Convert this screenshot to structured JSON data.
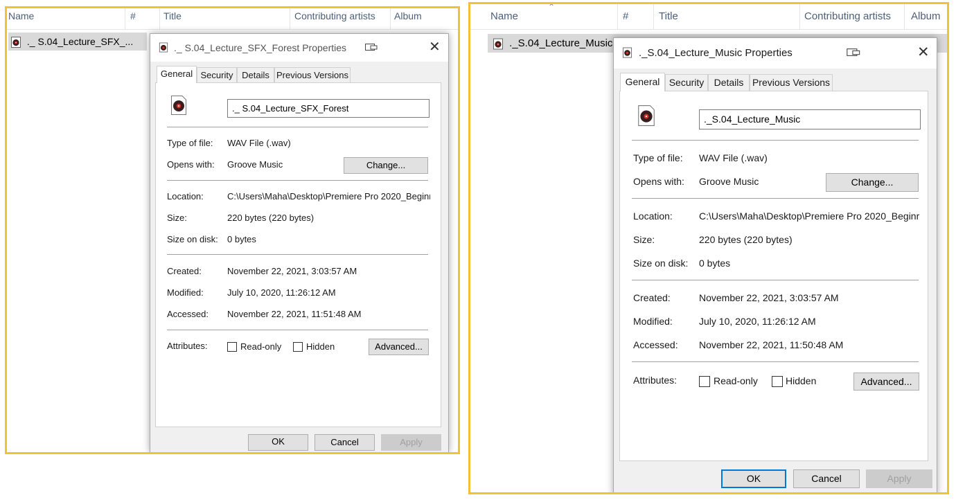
{
  "left": {
    "columns": {
      "name": "Name",
      "number": "#",
      "title": "Title",
      "artists": "Contributing artists",
      "album": "Album"
    },
    "file_row": {
      "name": "._ S.04_Lecture_SFX_..."
    },
    "dialog": {
      "title": "._ S.04_Lecture_SFX_Forest Properties",
      "tabs": [
        "General",
        "Security",
        "Details",
        "Previous Versions"
      ],
      "file_name_value": "._ S.04_Lecture_SFX_Forest",
      "type_label": "Type of file:",
      "type_value": "WAV File (.wav)",
      "opens_label": "Opens with:",
      "opens_value": "Groove Music",
      "change_button": "Change...",
      "location_label": "Location:",
      "location_value": "C:\\Users\\Maha\\Desktop\\Premiere Pro 2020_Beginr",
      "size_label": "Size:",
      "size_value": "220 bytes (220 bytes)",
      "size_disk_label": "Size on disk:",
      "size_disk_value": "0 bytes",
      "created_label": "Created:",
      "created_value": "November 22, 2021, 3:03:57 AM",
      "modified_label": "Modified:",
      "modified_value": "July 10, 2020, 11:26:12 AM",
      "accessed_label": "Accessed:",
      "accessed_value": "November 22, 2021, 11:51:48 AM",
      "attributes_label": "Attributes:",
      "readonly_label": "Read-only",
      "hidden_label": "Hidden",
      "advanced_button": "Advanced...",
      "ok_button": "OK",
      "cancel_button": "Cancel",
      "apply_button": "Apply"
    }
  },
  "right": {
    "columns": {
      "name": "Name",
      "number": "#",
      "title": "Title",
      "artists": "Contributing artists",
      "album": "Album"
    },
    "file_row": {
      "name": "._S.04_Lecture_Music"
    },
    "dialog": {
      "title": "._S.04_Lecture_Music Properties",
      "tabs": [
        "General",
        "Security",
        "Details",
        "Previous Versions"
      ],
      "file_name_value": "._S.04_Lecture_Music",
      "type_label": "Type of file:",
      "type_value": "WAV File (.wav)",
      "opens_label": "Opens with:",
      "opens_value": "Groove Music",
      "change_button": "Change...",
      "location_label": "Location:",
      "location_value": "C:\\Users\\Maha\\Desktop\\Premiere Pro 2020_Beginr",
      "size_label": "Size:",
      "size_value": "220 bytes (220 bytes)",
      "size_disk_label": "Size on disk:",
      "size_disk_value": "0 bytes",
      "created_label": "Created:",
      "created_value": "November 22, 2021, 3:03:57 AM",
      "modified_label": "Modified:",
      "modified_value": "July 10, 2020, 11:26:12 AM",
      "accessed_label": "Accessed:",
      "accessed_value": "November 22, 2021, 11:50:48 AM",
      "attributes_label": "Attributes:",
      "readonly_label": "Read-only",
      "hidden_label": "Hidden",
      "advanced_button": "Advanced...",
      "ok_button": "OK",
      "cancel_button": "Cancel",
      "apply_button": "Apply"
    }
  },
  "colors": {
    "highlight_border": "#f0c234",
    "primary_button_border": "#0078d7",
    "header_text": "#4c607a"
  },
  "icons": {
    "file": "audio-file-icon",
    "close": "close-icon",
    "pin": "snap-icon",
    "sort": "sort-up-icon"
  }
}
